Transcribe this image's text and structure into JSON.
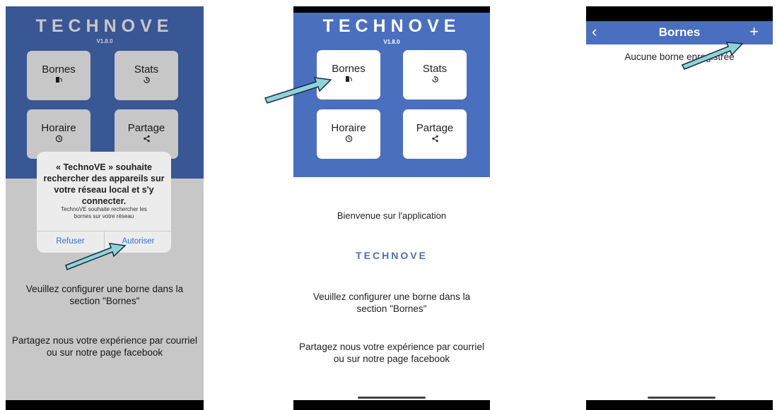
{
  "app": {
    "brand": "TECHNOVE",
    "version": "V1.8.0"
  },
  "home_tiles": {
    "bornes": "Bornes",
    "stats": "Stats",
    "horaire": "Horaire",
    "partage": "Partage"
  },
  "home_texts": {
    "welcome": "Bienvenue sur l'application",
    "brand_text": "TECHNOVE",
    "configure_line1": "Veuillez configurer une borne dans la",
    "configure_line2": "section \"Bornes\"",
    "share_line1": "Partagez nous votre expérience par courriel",
    "share_line2": "ou sur notre page facebook"
  },
  "permission_dialog": {
    "title_line1": "« TechnoVE » souhaite",
    "title_line2": "rechercher des appareils sur",
    "title_line3": "votre réseau local et s'y",
    "title_line4": "connecter.",
    "message_line1": "TechnoVE souhaite rechercher les",
    "message_line2": "bornes sur votre réseau",
    "deny_label": "Refuser",
    "allow_label": "Autoriser"
  },
  "bornes_screen": {
    "back_glyph": "‹",
    "title": "Bornes",
    "add_glyph": "+",
    "empty_text": "Aucune borne enregistrée"
  },
  "icons": {
    "bornes": "charger-icon",
    "stats": "history-icon",
    "horaire": "clock-icon",
    "partage": "share-icon"
  },
  "colors": {
    "brand_blue": "#4a6fbf",
    "dialog_button": "#2f6fd6",
    "annotation_arrow": "#8fd3d8"
  }
}
